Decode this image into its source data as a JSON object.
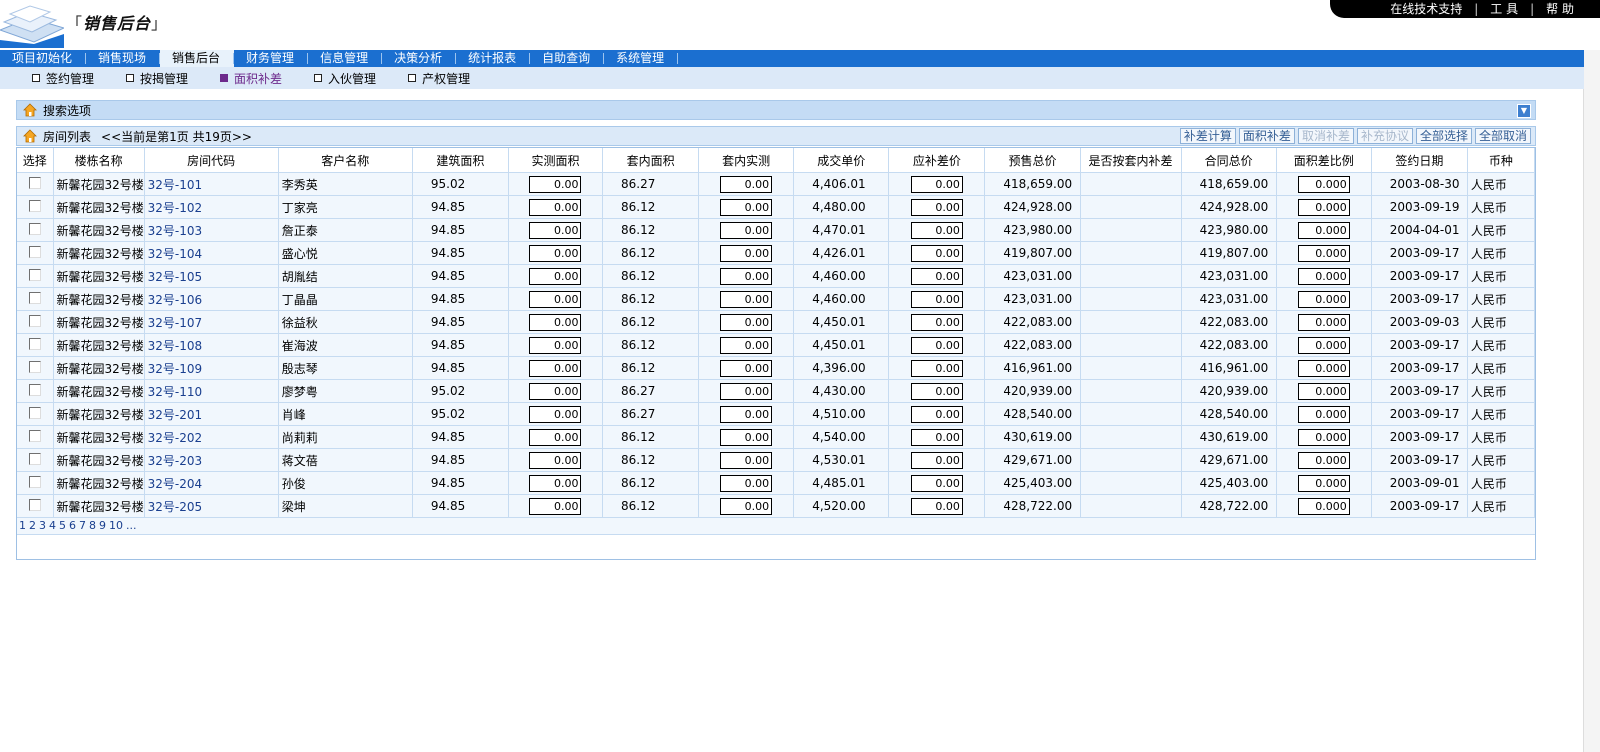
{
  "app": {
    "title": "销售后台",
    "toplinks": [
      "在线技术支持",
      "工 具",
      "帮 助"
    ]
  },
  "main_nav": [
    "项目初始化",
    "销售现场",
    "销售后台",
    "财务管理",
    "信息管理",
    "决策分析",
    "统计报表",
    "自助查询",
    "系统管理"
  ],
  "main_nav_active": "销售后台",
  "sub_nav": [
    "签约管理",
    "按揭管理",
    "面积补差",
    "入伙管理",
    "产权管理"
  ],
  "sub_nav_active": "面积补差",
  "search_panel": {
    "title": "搜索选项"
  },
  "list_panel": {
    "title": "房间列表",
    "page_info": "<<当前是第1页 共19页>>",
    "actions": [
      {
        "label": "补差计算",
        "enabled": true
      },
      {
        "label": "面积补差",
        "enabled": true
      },
      {
        "label": "取消补差",
        "enabled": false
      },
      {
        "label": "补充协议",
        "enabled": false
      },
      {
        "label": "全部选择",
        "enabled": true
      },
      {
        "label": "全部取消",
        "enabled": true
      }
    ]
  },
  "table": {
    "columns": [
      "选择",
      "楼栋名称",
      "房间代码",
      "客户名称",
      "建筑面积",
      "实测面积",
      "套内面积",
      "套内实测",
      "成交单价",
      "应补差价",
      "预售总价",
      "是否按套内补差",
      "合同总价",
      "面积差比例",
      "签约日期",
      "币种"
    ],
    "rows": [
      {
        "building": "新馨花园32号楼",
        "room": "32号-101",
        "customer": "李秀英",
        "area": "95.02",
        "measured": "0.00",
        "inner": "86.27",
        "inner_measured": "0.00",
        "price": "4,406.01",
        "diff": "0.00",
        "presale": "418,659.00",
        "by_inner": "",
        "contract": "418,659.00",
        "ratio": "0.000",
        "date": "2003-08-30",
        "currency": "人民币"
      },
      {
        "building": "新馨花园32号楼",
        "room": "32号-102",
        "customer": "丁家亮",
        "area": "94.85",
        "measured": "0.00",
        "inner": "86.12",
        "inner_measured": "0.00",
        "price": "4,480.00",
        "diff": "0.00",
        "presale": "424,928.00",
        "by_inner": "",
        "contract": "424,928.00",
        "ratio": "0.000",
        "date": "2003-09-19",
        "currency": "人民币"
      },
      {
        "building": "新馨花园32号楼",
        "room": "32号-103",
        "customer": "詹正泰",
        "area": "94.85",
        "measured": "0.00",
        "inner": "86.12",
        "inner_measured": "0.00",
        "price": "4,470.01",
        "diff": "0.00",
        "presale": "423,980.00",
        "by_inner": "",
        "contract": "423,980.00",
        "ratio": "0.000",
        "date": "2004-04-01",
        "currency": "人民币"
      },
      {
        "building": "新馨花园32号楼",
        "room": "32号-104",
        "customer": "盛心悦",
        "area": "94.85",
        "measured": "0.00",
        "inner": "86.12",
        "inner_measured": "0.00",
        "price": "4,426.01",
        "diff": "0.00",
        "presale": "419,807.00",
        "by_inner": "",
        "contract": "419,807.00",
        "ratio": "0.000",
        "date": "2003-09-17",
        "currency": "人民币"
      },
      {
        "building": "新馨花园32号楼",
        "room": "32号-105",
        "customer": "胡胤结",
        "area": "94.85",
        "measured": "0.00",
        "inner": "86.12",
        "inner_measured": "0.00",
        "price": "4,460.00",
        "diff": "0.00",
        "presale": "423,031.00",
        "by_inner": "",
        "contract": "423,031.00",
        "ratio": "0.000",
        "date": "2003-09-17",
        "currency": "人民币"
      },
      {
        "building": "新馨花园32号楼",
        "room": "32号-106",
        "customer": "丁晶晶",
        "area": "94.85",
        "measured": "0.00",
        "inner": "86.12",
        "inner_measured": "0.00",
        "price": "4,460.00",
        "diff": "0.00",
        "presale": "423,031.00",
        "by_inner": "",
        "contract": "423,031.00",
        "ratio": "0.000",
        "date": "2003-09-17",
        "currency": "人民币"
      },
      {
        "building": "新馨花园32号楼",
        "room": "32号-107",
        "customer": "徐益秋",
        "area": "94.85",
        "measured": "0.00",
        "inner": "86.12",
        "inner_measured": "0.00",
        "price": "4,450.01",
        "diff": "0.00",
        "presale": "422,083.00",
        "by_inner": "",
        "contract": "422,083.00",
        "ratio": "0.000",
        "date": "2003-09-03",
        "currency": "人民币"
      },
      {
        "building": "新馨花园32号楼",
        "room": "32号-108",
        "customer": "崔海波",
        "area": "94.85",
        "measured": "0.00",
        "inner": "86.12",
        "inner_measured": "0.00",
        "price": "4,450.01",
        "diff": "0.00",
        "presale": "422,083.00",
        "by_inner": "",
        "contract": "422,083.00",
        "ratio": "0.000",
        "date": "2003-09-17",
        "currency": "人民币"
      },
      {
        "building": "新馨花园32号楼",
        "room": "32号-109",
        "customer": "殷志琴",
        "area": "94.85",
        "measured": "0.00",
        "inner": "86.12",
        "inner_measured": "0.00",
        "price": "4,396.00",
        "diff": "0.00",
        "presale": "416,961.00",
        "by_inner": "",
        "contract": "416,961.00",
        "ratio": "0.000",
        "date": "2003-09-17",
        "currency": "人民币"
      },
      {
        "building": "新馨花园32号楼",
        "room": "32号-110",
        "customer": "廖梦粤",
        "area": "95.02",
        "measured": "0.00",
        "inner": "86.27",
        "inner_measured": "0.00",
        "price": "4,430.00",
        "diff": "0.00",
        "presale": "420,939.00",
        "by_inner": "",
        "contract": "420,939.00",
        "ratio": "0.000",
        "date": "2003-09-17",
        "currency": "人民币"
      },
      {
        "building": "新馨花园32号楼",
        "room": "32号-201",
        "customer": "肖峰",
        "area": "95.02",
        "measured": "0.00",
        "inner": "86.27",
        "inner_measured": "0.00",
        "price": "4,510.00",
        "diff": "0.00",
        "presale": "428,540.00",
        "by_inner": "",
        "contract": "428,540.00",
        "ratio": "0.000",
        "date": "2003-09-17",
        "currency": "人民币"
      },
      {
        "building": "新馨花园32号楼",
        "room": "32号-202",
        "customer": "尚莉莉",
        "area": "94.85",
        "measured": "0.00",
        "inner": "86.12",
        "inner_measured": "0.00",
        "price": "4,540.00",
        "diff": "0.00",
        "presale": "430,619.00",
        "by_inner": "",
        "contract": "430,619.00",
        "ratio": "0.000",
        "date": "2003-09-17",
        "currency": "人民币"
      },
      {
        "building": "新馨花园32号楼",
        "room": "32号-203",
        "customer": "蒋文蓓",
        "area": "94.85",
        "measured": "0.00",
        "inner": "86.12",
        "inner_measured": "0.00",
        "price": "4,530.01",
        "diff": "0.00",
        "presale": "429,671.00",
        "by_inner": "",
        "contract": "429,671.00",
        "ratio": "0.000",
        "date": "2003-09-17",
        "currency": "人民币"
      },
      {
        "building": "新馨花园32号楼",
        "room": "32号-204",
        "customer": "孙俊",
        "area": "94.85",
        "measured": "0.00",
        "inner": "86.12",
        "inner_measured": "0.00",
        "price": "4,485.01",
        "diff": "0.00",
        "presale": "425,403.00",
        "by_inner": "",
        "contract": "425,403.00",
        "ratio": "0.000",
        "date": "2003-09-01",
        "currency": "人民币"
      },
      {
        "building": "新馨花园32号楼",
        "room": "32号-205",
        "customer": "梁坤",
        "area": "94.85",
        "measured": "0.00",
        "inner": "86.12",
        "inner_measured": "0.00",
        "price": "4,520.00",
        "diff": "0.00",
        "presale": "428,722.00",
        "by_inner": "",
        "contract": "428,722.00",
        "ratio": "0.000",
        "date": "2003-09-17",
        "currency": "人民币"
      }
    ]
  },
  "pager": {
    "pages": [
      "1",
      "2",
      "3",
      "4",
      "5",
      "6",
      "7",
      "8",
      "9",
      "10",
      "..."
    ]
  },
  "colors": {
    "nav_blue": "#1b6fd0",
    "subnav_bg": "#dce9f8",
    "panel_bar": "#c4dcf5",
    "row_bg": "#f1f7fd",
    "active_sub": "#6d2a8c"
  }
}
